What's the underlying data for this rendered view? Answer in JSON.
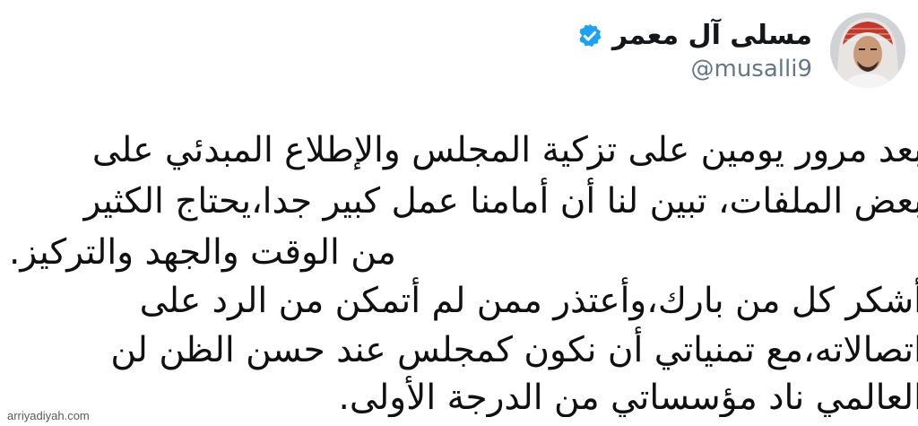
{
  "author": {
    "display_name": "مسلى آل معمر",
    "handle": "@musalli9",
    "verified": true,
    "verified_color": "#1da1f2"
  },
  "tweet": {
    "lines": [
      "بعد مرور يومين على تزكية المجلس والإطلاع المبدئي على",
      "بعض الملفات، تبين لنا أن أمامنا عمل كبير جدا،يحتاج الكثير",
      "من الوقت والجهد والتركيز.",
      "أشكر كل من بارك،وأعتذر ممن لم أتمكن من الرد على",
      "اتصالاته،مع تمنياتي أن نكون كمجلس عند حسن الظن لن",
      "العالمي ناد مؤسساتي من الدرجة الأولى."
    ]
  },
  "watermark": "arriyadiyah.com"
}
